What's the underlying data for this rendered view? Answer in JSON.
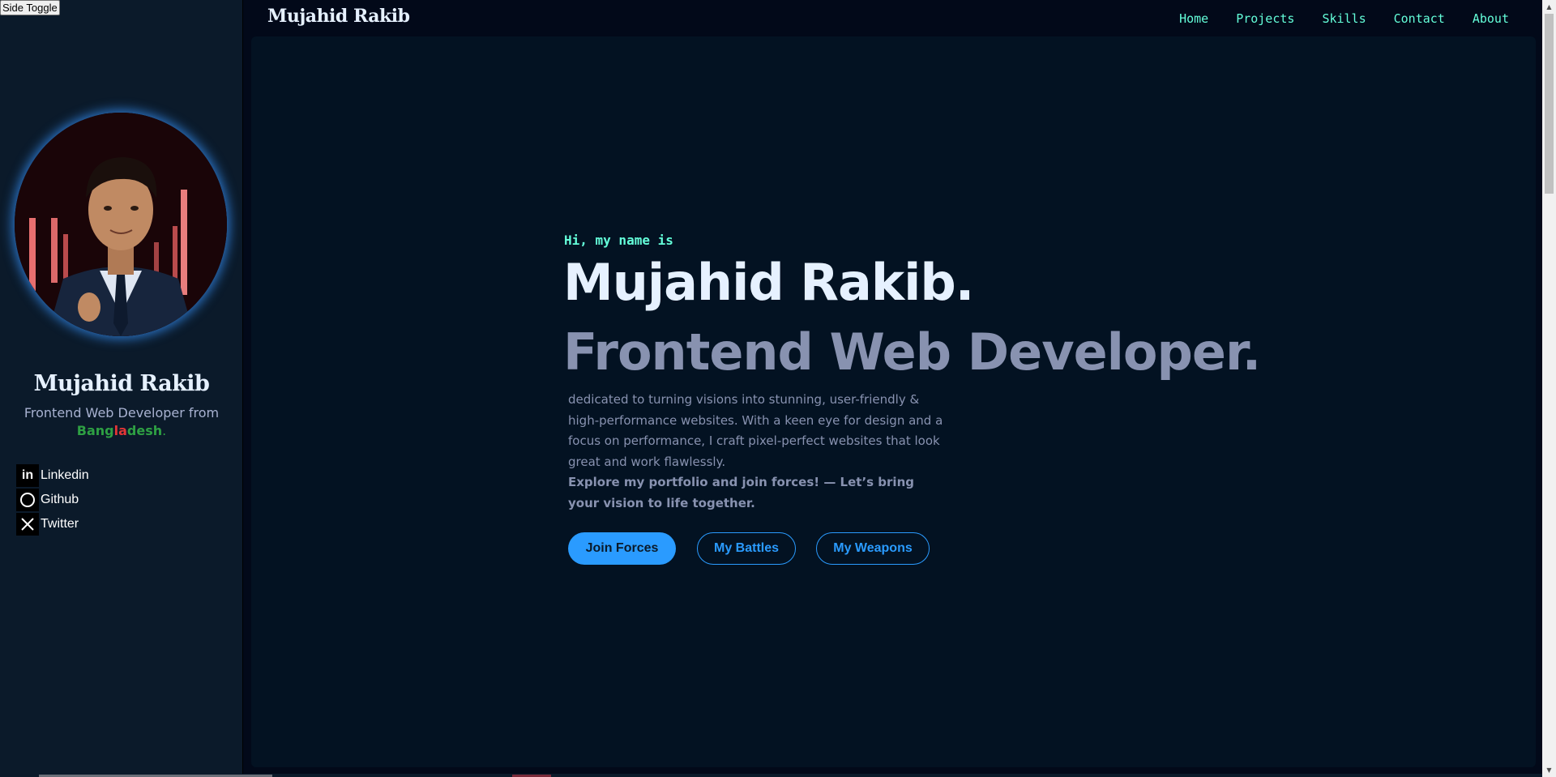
{
  "side_toggle": "Side Toggle",
  "sidebar": {
    "name": "Mujahid Rakib",
    "subtitle_prefix": "Frontend Web Developer from",
    "country_part1": "Bang",
    "country_part2": "la",
    "country_part3": "desh",
    "country_suffix": ".",
    "socials": [
      {
        "label": "Linkedin",
        "icon": "linkedin-icon"
      },
      {
        "label": "Github",
        "icon": "github-icon"
      },
      {
        "label": "Twitter",
        "icon": "x-twitter-icon"
      }
    ]
  },
  "header": {
    "logo": "Mujahid Rakib",
    "nav": [
      "Home",
      "Projects",
      "Skills",
      "Contact",
      "About"
    ]
  },
  "hero": {
    "greeting": "Hi, my name is",
    "name": "Mujahid Rakib.",
    "role": "Frontend Web Developer.",
    "description": "dedicated to turning visions into stunning, user-friendly & high-performance websites. With a keen eye for design and a focus on performance, I craft pixel-perfect websites that look great and work flawlessly.",
    "cta_text": "Explore my portfolio and join forces! — Let’s bring your vision to life together.",
    "buttons": {
      "primary": "Join Forces",
      "battles": "My Battles",
      "weapons": "My Weapons"
    }
  },
  "colors": {
    "accent": "#64ffda",
    "button": "#2a9bff",
    "background": "#020919",
    "sidebar": "#0b1a2a"
  }
}
